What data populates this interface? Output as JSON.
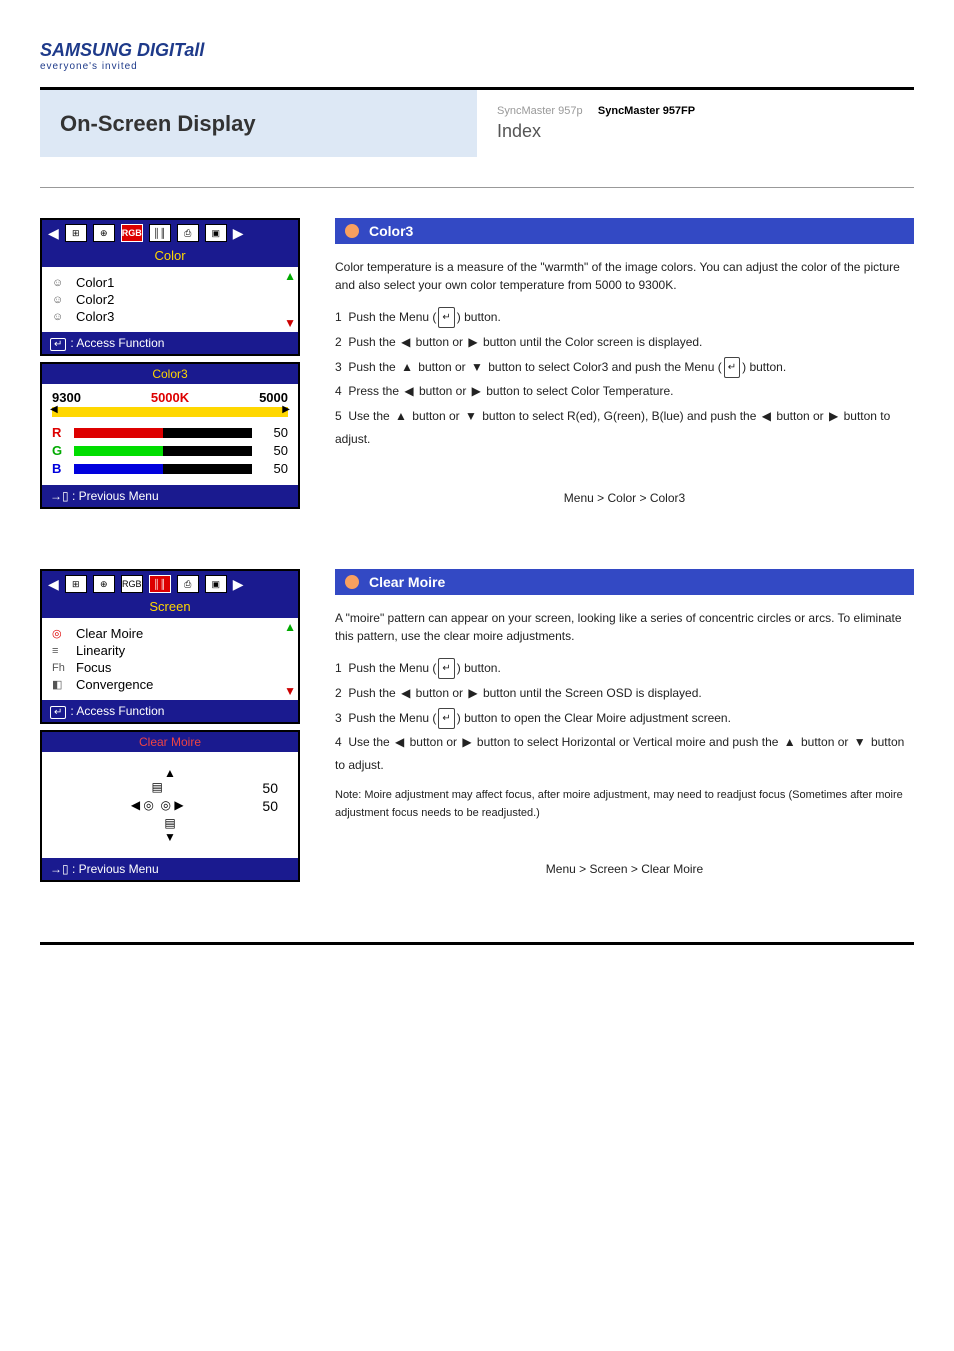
{
  "logo": {
    "brand": "SAMSUNG DIGITall",
    "tagline": "everyone's invited"
  },
  "header": {
    "title": "On-Screen Display",
    "tab1": "SyncMaster 957p",
    "tab2": "SyncMaster 957FP",
    "page_ref": "Index"
  },
  "color_section": {
    "tab_bar_title": "Color",
    "items": [
      "Color1",
      "Color2",
      "Color3"
    ],
    "access_label": ": Access Function",
    "sub_title": "Color3",
    "scale_left": "9300",
    "scale_mid": "5000K",
    "scale_right": "5000",
    "r_label": "R",
    "g_label": "G",
    "b_label": "B",
    "r_val": "50",
    "g_val": "50",
    "b_val": "50",
    "prev_label": ": Previous Menu",
    "right_title": "Color3",
    "right_desc": "Color temperature is a measure of the \"warmth\" of the image colors. You can adjust the color of the picture and also select your own color temperature from 5000 to 9300K.",
    "steps": {
      "s1": "1  Push the Menu (",
      "s1b": ") button.",
      "s2a": "2  Push the",
      "s2b": "button or",
      "s2c": "button until the Color screen is displayed.",
      "s3a": "3  Push the",
      "s3b": "button or",
      "s3c": "button to select Color3 and push the Menu (",
      "s3d": ") button.",
      "s4a": "4  Press the",
      "s4b": "button or",
      "s4c": "button to select Color Temperature.",
      "s5a": "5  Use the",
      "s5b": "button or",
      "s5c": "button to select R(ed), G(reen), B(lue) and push the",
      "s5d": "button or",
      "s5e": "button to adjust."
    },
    "menu_ref": "Menu > Color > Color3"
  },
  "screen_section": {
    "tab_bar_title": "Screen",
    "items": [
      "Clear Moire",
      "Linearity",
      "Focus",
      "Convergence"
    ],
    "access_label": ": Access Function",
    "sub_title": "Clear Moire",
    "h_val": "50",
    "v_val": "50",
    "prev_label": ": Previous Menu",
    "right_title": "Clear Moire",
    "right_desc": "A \"moire\" pattern can appear on your screen, looking like a series of concentric circles or arcs. To eliminate this pattern, use the clear moire adjustments.",
    "steps": {
      "s1": "1  Push the Menu (",
      "s1b": ") button.",
      "s2a": "2  Push the",
      "s2b": "button or",
      "s2c": "button until the Screen OSD is displayed.",
      "s3a": "3  Push the Menu (",
      "s3b": ") button to open the Clear Moire adjustment screen.",
      "s4a": "4  Use the",
      "s4b": "button or",
      "s4c": "button to select Horizontal or Vertical moire and push the",
      "s4d": "button or",
      "s4e": "button to adjust."
    },
    "note": "Note: Moire adjustment may affect focus, after moire adjustment, may need to readjust focus (Sometimes after moire adjustment focus needs to be readjusted.)",
    "menu_ref": "Menu > Screen > Clear Moire"
  }
}
